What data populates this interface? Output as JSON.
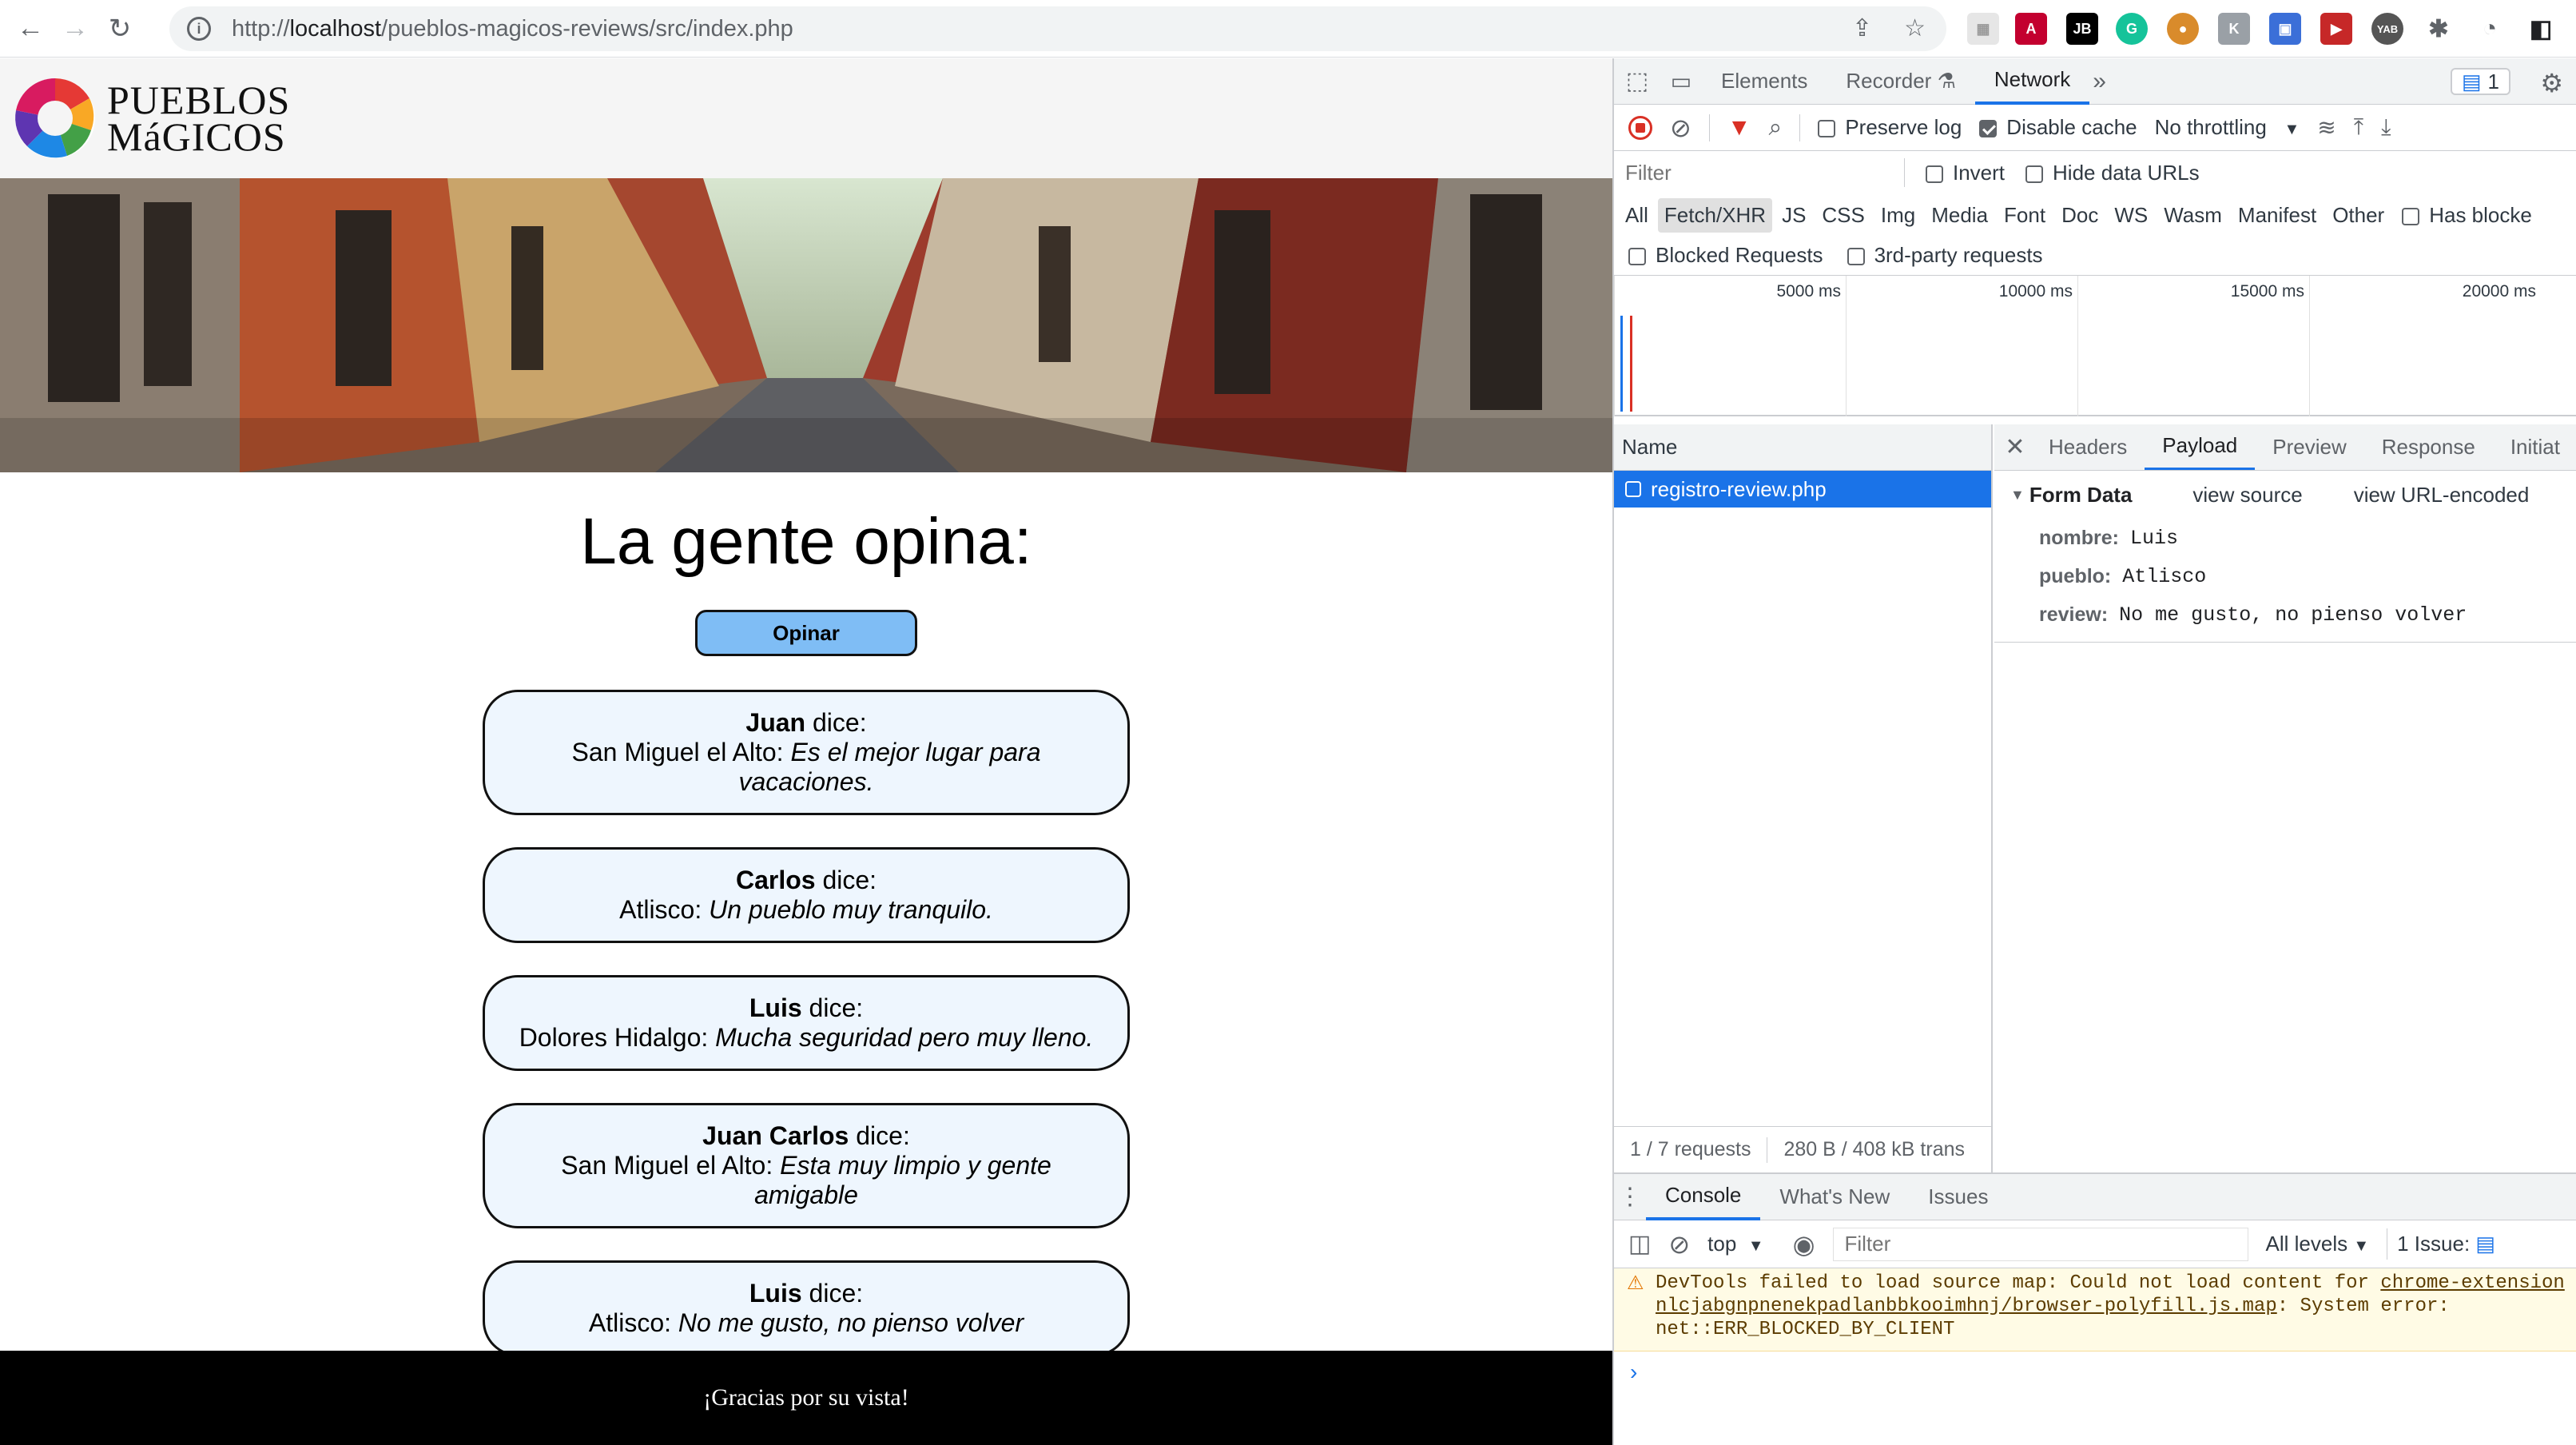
{
  "browser": {
    "url_prefix": "http://",
    "url_host": "localhost",
    "url_path": "/pueblos-magicos-reviews/src/index.php"
  },
  "page": {
    "logo_line1": "PUEBLOS",
    "logo_line2": "MáGICOS",
    "heading": "La gente opina:",
    "opinar_button": "Opinar",
    "reviews": [
      {
        "name": "Juan",
        "says": "dice:",
        "town": "San Miguel el Alto:",
        "text": "Es el mejor lugar para vacaciones."
      },
      {
        "name": "Carlos",
        "says": "dice:",
        "town": "Atlisco:",
        "text": "Un pueblo muy tranquilo."
      },
      {
        "name": "Luis",
        "says": "dice:",
        "town": "Dolores Hidalgo:",
        "text": "Mucha seguridad pero muy lleno."
      },
      {
        "name": "Juan Carlos",
        "says": "dice:",
        "town": "San Miguel el Alto:",
        "text": "Esta muy limpio y gente amigable"
      },
      {
        "name": "Luis",
        "says": "dice:",
        "town": "Atlisco:",
        "text": "No me gusto, no pienso volver"
      }
    ],
    "footer": "¡Gracias por su vista!"
  },
  "devtools": {
    "tabs": [
      "Elements",
      "Recorder",
      "Network"
    ],
    "active_tab": "Network",
    "issues_badge": "1",
    "network": {
      "preserve_log": "Preserve log",
      "disable_cache": "Disable cache",
      "throttling": "No throttling",
      "filter_placeholder": "Filter",
      "invert": "Invert",
      "hide_data_urls": "Hide data URLs",
      "types": [
        "All",
        "Fetch/XHR",
        "JS",
        "CSS",
        "Img",
        "Media",
        "Font",
        "Doc",
        "WS",
        "Wasm",
        "Manifest",
        "Other"
      ],
      "active_type": "Fetch/XHR",
      "has_blocked": "Has blocke",
      "blocked_requests": "Blocked Requests",
      "third_party": "3rd-party requests",
      "timeline_ticks": [
        "5000 ms",
        "10000 ms",
        "15000 ms",
        "20000 ms"
      ],
      "name_column": "Name",
      "requests": [
        "registro-review.php"
      ],
      "footer_requests": "1 / 7 requests",
      "footer_transferred": "280 B / 408 kB trans",
      "detail_tabs": [
        "Headers",
        "Payload",
        "Preview",
        "Response",
        "Initiat"
      ],
      "active_detail_tab": "Payload",
      "form_data_title": "Form Data",
      "view_source": "view source",
      "view_url_encoded": "view URL-encoded",
      "form_fields": [
        {
          "key": "nombre:",
          "value": "Luis"
        },
        {
          "key": "pueblo:",
          "value": "Atlisco"
        },
        {
          "key": "review:",
          "value": "No me gusto, no pienso volver"
        }
      ]
    },
    "drawer": {
      "tabs": [
        "Console",
        "What's New",
        "Issues"
      ],
      "active_tab": "Console",
      "context": "top",
      "filter_placeholder": "Filter",
      "levels": "All levels",
      "issue_count": "1 Issue:",
      "warning_line1": "DevTools failed to load source map: Could not load content for ",
      "warning_link1": "chrome-extension",
      "warning_link2": "nlcjabgnpnenekpadlanbbkooimhnj/browser-polyfill.js.map",
      "warning_line2_rest": ": System error:",
      "warning_line3": "net::ERR_BLOCKED_BY_CLIENT"
    }
  },
  "colors": {
    "accent": "#1a73e8",
    "opinar_bg": "#7fbdf5",
    "card_bg": "#eef6fe",
    "footer_bg": "#000000"
  }
}
